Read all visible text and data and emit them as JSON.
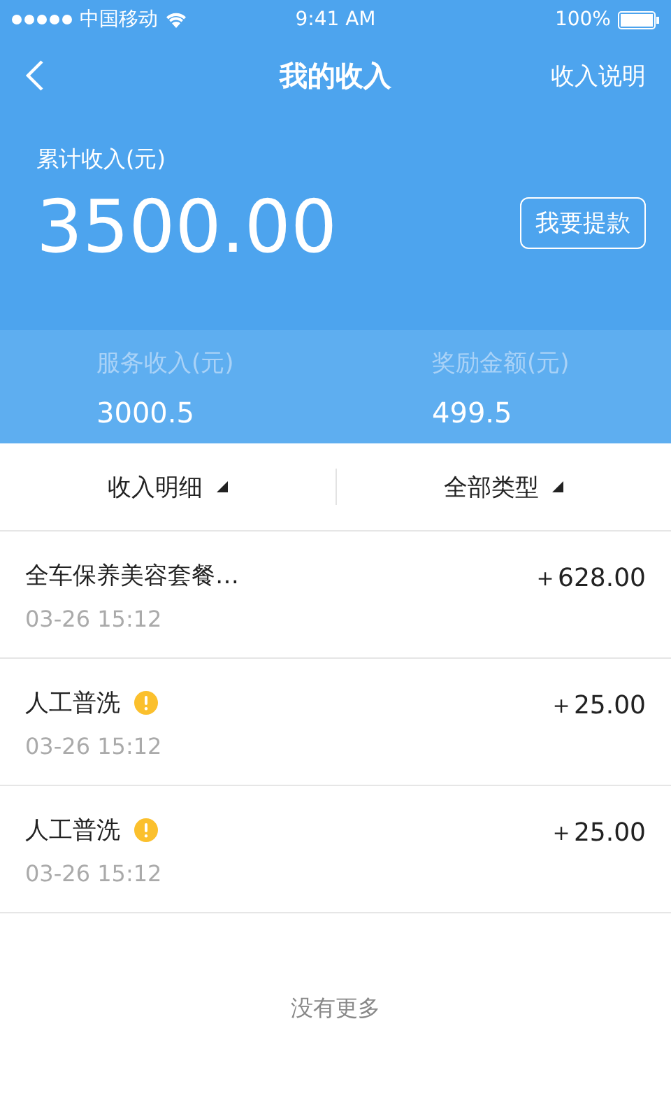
{
  "status_bar": {
    "carrier": "中国移动",
    "time": "9:41 AM",
    "battery": "100%"
  },
  "nav": {
    "back": true,
    "title": "我的收入",
    "action": "收入说明"
  },
  "summary": {
    "label": "累计收入(元)",
    "amount": "3500.00",
    "withdraw_button": "我要提款"
  },
  "stats": [
    {
      "label": "服务收入(元)",
      "value": "3000.5"
    },
    {
      "label": "奖励金额(元)",
      "value": "499.5"
    }
  ],
  "filters": [
    {
      "label": "收入明细"
    },
    {
      "label": "全部类型"
    }
  ],
  "records": [
    {
      "title": "全车保养美容套餐…",
      "warning": false,
      "date": "03-26 15:12",
      "amount": "＋628.00"
    },
    {
      "title": "人工普洗",
      "warning": true,
      "date": "03-26 15:12",
      "amount": "＋25.00"
    },
    {
      "title": "人工普洗",
      "warning": true,
      "date": "03-26 15:12",
      "amount": "＋25.00"
    }
  ],
  "footer": "没有更多"
}
